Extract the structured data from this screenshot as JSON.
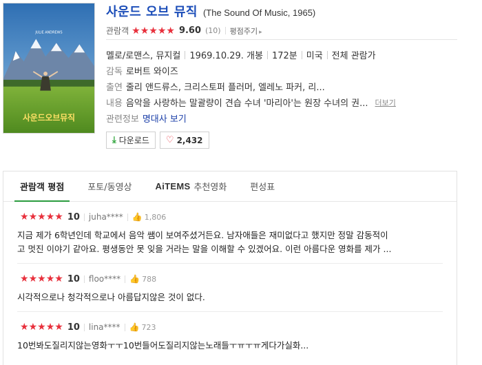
{
  "movie": {
    "title_ko": "사운드 오브 뮤직",
    "title_en": "(The Sound Of Music, 1965)",
    "poster_text": "사운드오브뮤직"
  },
  "rating": {
    "label": "관람객",
    "score": "9.60",
    "stars": 5,
    "count": "(10)",
    "rate_link": "평점주기"
  },
  "meta": {
    "genre": "멜로/로맨스, 뮤지컬",
    "release": "1969.10.29. 개봉",
    "runtime": "172분",
    "country": "미국",
    "grade": "전체 관람가",
    "director_label": "감독",
    "director": "로버트 와이즈",
    "cast_label": "출연",
    "cast": "줄리 앤드류스, 크리스토퍼 플러머, 엘레노 파커, 리...",
    "plot_label": "내용",
    "plot": "음악을 사랑하는 말괄량이 견습 수녀 '마리아'는 원장 수녀의 권...",
    "more_link": "더보기",
    "related_label": "관련정보",
    "related_link": "명대사 보기"
  },
  "buttons": {
    "download": "다운로드",
    "likes": "2,432"
  },
  "tabs": [
    {
      "label": "관람객 평점",
      "active": true
    },
    {
      "label": "포토/동영상",
      "active": false
    },
    {
      "label": "추천영화",
      "logo": "AiTEMS",
      "active": false
    },
    {
      "label": "편성표",
      "active": false
    }
  ],
  "reviews": [
    {
      "stars": 5,
      "score": "10",
      "user": "juha****",
      "likes": "1,806",
      "lines": [
        "지금 제가 6학년인데 학교에서 음악 쌤이 보여주셨거든요. 남자애들은 재미없다고 했지만 정말 감동적이",
        "고 멋진 이야기 같아요. 평생동안 못 잊을 거라는 말을 이해할 수 있겠어요. 이런 아름다운 영화를 제가 ..."
      ]
    },
    {
      "stars": 5,
      "score": "10",
      "user": "floo****",
      "likes": "788",
      "lines": [
        "시각적으로나 청각적으로나 아름답지않은 것이 없다."
      ]
    },
    {
      "stars": 5,
      "score": "10",
      "user": "lina****",
      "likes": "723",
      "lines": [
        "10번봐도질리지않는영화ㅜㅜ10번들어도질리지않는노래들ㅜㅠㅜㅠ게다가실화..."
      ]
    }
  ]
}
